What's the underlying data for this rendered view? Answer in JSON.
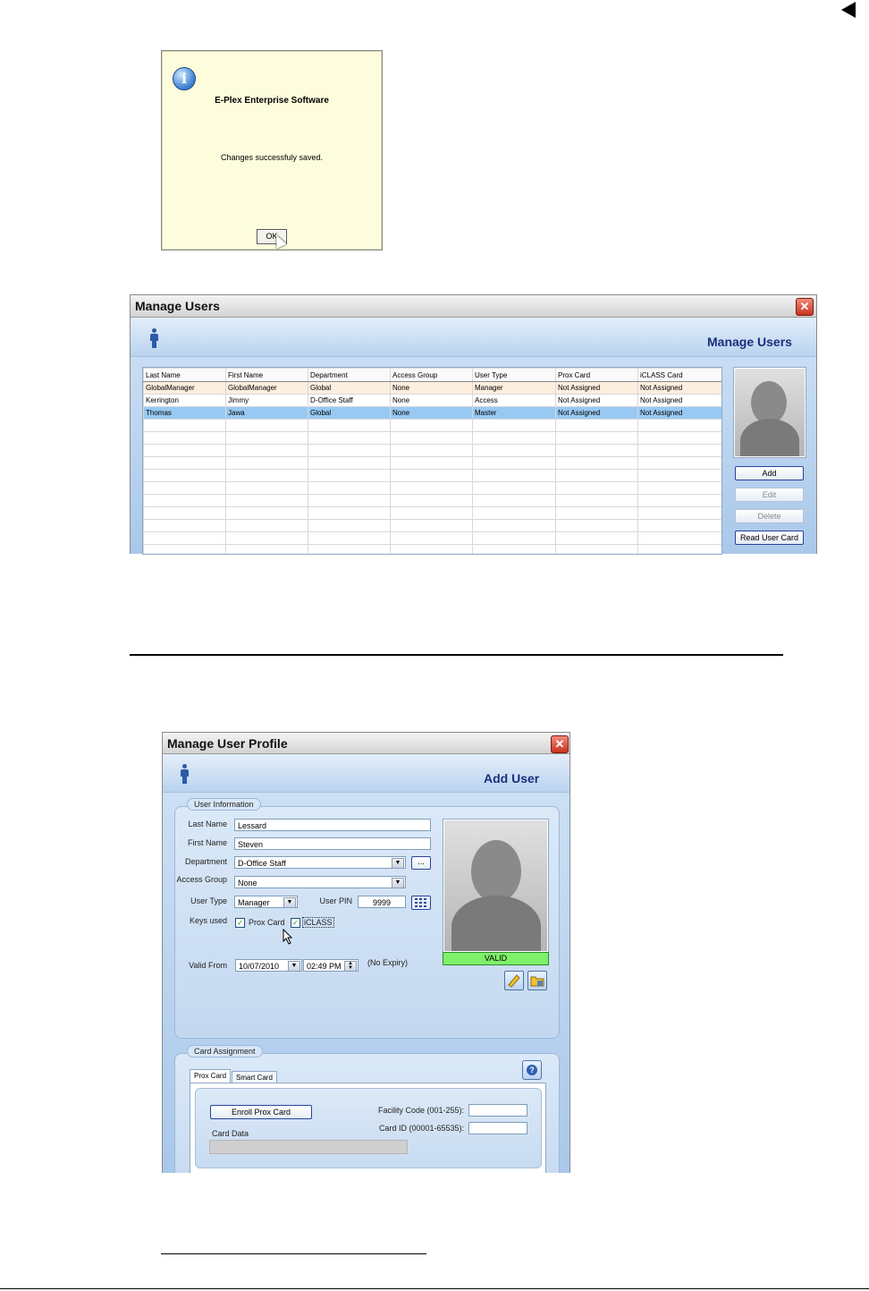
{
  "page_marker": "◀",
  "message_box": {
    "title": "E-Plex Enterprise Software",
    "message": "Changes successfuly saved.",
    "ok_label": "OK"
  },
  "manage_users": {
    "window_title": "Manage Users",
    "header_title": "Manage Users",
    "columns": [
      "Last Name",
      "First Name",
      "Department",
      "Access Group",
      "User Type",
      "Prox Card",
      "iCLASS Card"
    ],
    "rows": [
      [
        "GlobalManager",
        "GlobalManager",
        "Global",
        "None",
        "Manager",
        "Not Assigned",
        "Not Assigned"
      ],
      [
        "Kerrington",
        "Jimmy",
        "D-Office Staff",
        "None",
        "Access",
        "Not Assigned",
        "Not Assigned"
      ],
      [
        "Thomas",
        "Jawa",
        "Global",
        "None",
        "Master",
        "Not Assigned",
        "Not Assigned"
      ]
    ],
    "buttons": {
      "add": "Add",
      "edit": "Edit",
      "delete": "Delete",
      "read_user_card": "Read User Card"
    }
  },
  "profile": {
    "window_title": "Manage User Profile",
    "header_title": "Add User",
    "user_info_legend": "User Information",
    "labels": {
      "last_name": "Last Name",
      "first_name": "First Name",
      "department": "Department",
      "access_group": "Access Group",
      "user_type": "User Type",
      "user_pin": "User PIN",
      "keys_used": "Keys used",
      "valid_from": "Valid From"
    },
    "values": {
      "last_name": "Lessard",
      "first_name": "Steven",
      "department": "D-Office Staff",
      "access_group": "None",
      "user_type": "Manager",
      "user_pin": "9999",
      "valid_date": "10/07/2010",
      "valid_time": "02:49 PM",
      "no_expiry": "(No Expiry)"
    },
    "browse_label": "...",
    "keys": {
      "prox_card": "Prox Card",
      "iclass": "iCLASS",
      "prox_checked": true,
      "iclass_checked": true
    },
    "photo_status": "VALID",
    "card_assignment": {
      "legend": "Card Assignment",
      "tabs": [
        "Prox Card",
        "Smart Card"
      ],
      "enroll_label": "Enroll Prox Card",
      "card_data_label": "Card Data",
      "facility_code_label": "Facility Code (001-255):",
      "card_id_label": "Card ID (00001-65535):",
      "facility_code": "",
      "card_id": ""
    },
    "help_icon": "?"
  },
  "colors": {
    "selected_row": "#98c9f2",
    "highlight_row": "#fdeede",
    "header_text": "#1a2f7c",
    "valid_bar": "#7ef06a"
  }
}
